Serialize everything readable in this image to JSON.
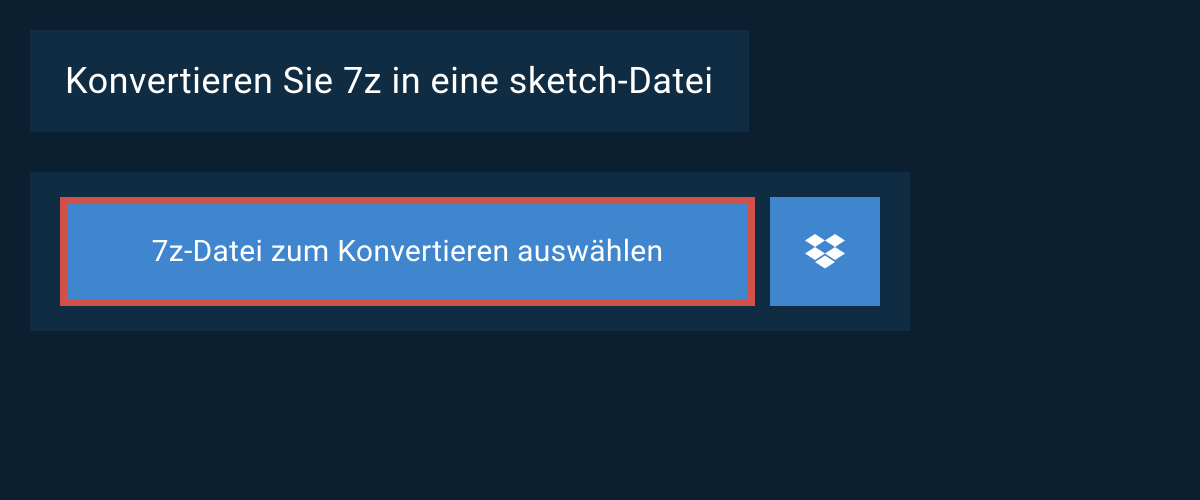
{
  "title": "Konvertieren Sie 7z in eine sketch-Datei",
  "buttons": {
    "select_file_label": "7z-Datei zum Konvertieren auswählen"
  },
  "colors": {
    "background_dark": "#0c1f30",
    "panel": "#102c42",
    "button_blue": "#3f86cf",
    "highlight_border": "#d15149"
  }
}
